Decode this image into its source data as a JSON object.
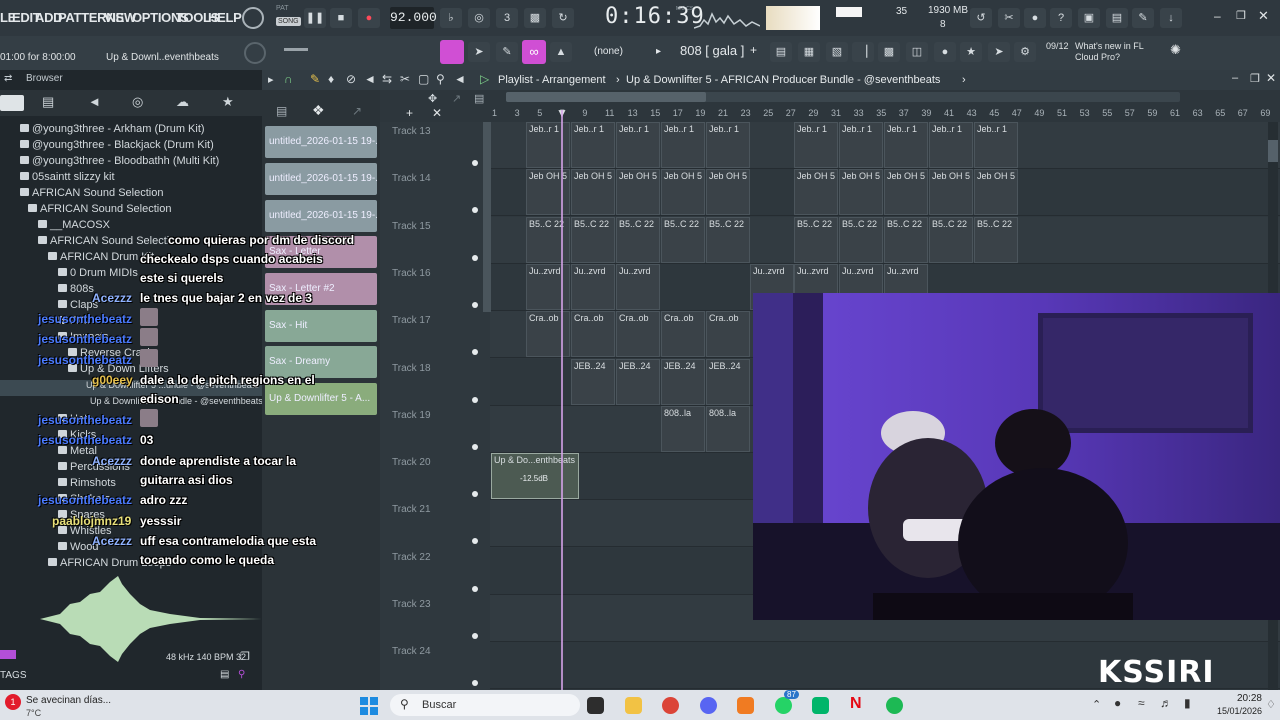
{
  "menu": {
    "items": [
      "LE",
      "EDIT",
      "ADD",
      "PATTERNS",
      "VIEW",
      "OPTIONS",
      "TOOLS",
      "HELP"
    ],
    "song_label": "SONG",
    "pat_label": "PAT"
  },
  "transport": {
    "tempo": "92.000",
    "clock": "0:16:39",
    "clock_unit": "M:S:CS",
    "cpu_percent": "35",
    "memory": "1930 MB",
    "voices": "8"
  },
  "hint_bar": {
    "time": "01:00 for 8:00:00",
    "project": "Up & Downl..eventhbeats",
    "pattern_name": "(none)",
    "channel_name": "808 [ gala ]",
    "news_counter": "09/12",
    "news_text": "What's new in FL Cloud Pro?"
  },
  "browser": {
    "title": "Browser",
    "items": [
      {
        "label": "@young3three - Arkham (Drum Kit)"
      },
      {
        "label": "@young3three - Blackjack (Drum Kit)"
      },
      {
        "label": "@young3three - Bloodbathh (Multi Kit)"
      },
      {
        "label": "05saintt slizzy kit"
      },
      {
        "label": "AFRICAN Sound Selection"
      },
      {
        "label": "AFRICAN Sound Selection"
      },
      {
        "label": "__MACOSX"
      },
      {
        "label": "AFRICAN Sound Selection"
      },
      {
        "label": "AFRICAN Drum Kit"
      },
      {
        "label": "0 Drum MIDIs"
      },
      {
        "label": "808s"
      },
      {
        "label": "Claps"
      },
      {
        "label": "FXs"
      },
      {
        "label": "Impacts"
      },
      {
        "label": "Reverse Crash"
      },
      {
        "label": "Up & Down Lifters"
      },
      {
        "label": "Up & Downlifter 5 ...undle - @seventhbeats"
      },
      {
        "label": "Up & Downlifter 5 ...undle - @seventhbeats"
      },
      {
        "label": "Hats"
      },
      {
        "label": "Kicks"
      },
      {
        "label": "Metal"
      },
      {
        "label": "Percussions"
      },
      {
        "label": "Rimshots"
      },
      {
        "label": "Shakers"
      },
      {
        "label": "Snares"
      },
      {
        "label": "Whistles"
      },
      {
        "label": "Wood"
      },
      {
        "label": "AFRICAN Drum Loops"
      }
    ],
    "sample_info": "48 kHz 140 BPM 32",
    "tags_label": "TAGS"
  },
  "patterns": [
    {
      "label": "untitled_2026-01-15 19-..."
    },
    {
      "label": "untitled_2026-01-15 19-..."
    },
    {
      "label": "untitled_2026-01-15 19-..."
    },
    {
      "label": "Sax - Letter"
    },
    {
      "label": "Sax - Letter #2"
    },
    {
      "label": "Sax - Hit"
    },
    {
      "label": "Sax - Dreamy"
    },
    {
      "label": "Up & Downlifter 5 - A..."
    }
  ],
  "playlist": {
    "title": "Playlist - Arrangement",
    "breadcrumb": "Up & Downlifter 5 - AFRICAN Producer Bundle - @seventhbeats",
    "ruler": [
      "1",
      "3",
      "5",
      "7",
      "9",
      "11",
      "13",
      "15",
      "17",
      "19",
      "21",
      "23",
      "25",
      "27",
      "29",
      "31",
      "33",
      "35",
      "37",
      "39",
      "41",
      "43",
      "45",
      "47",
      "49",
      "51",
      "53",
      "55",
      "57",
      "59",
      "61",
      "63",
      "65",
      "67",
      "69"
    ],
    "tracks": [
      {
        "name": "Track 13",
        "clip_label": "Jeb..r 1"
      },
      {
        "name": "Track 14",
        "clip_label": "Jeb OH 5"
      },
      {
        "name": "Track 15",
        "clip_label": "B5..C 22"
      },
      {
        "name": "Track 16",
        "clip_label": "Ju..zvrd"
      },
      {
        "name": "Track 17",
        "clip_label": "Cra..ob"
      },
      {
        "name": "Track 18",
        "clip_label": "JEB..24"
      },
      {
        "name": "Track 19",
        "clip_label": "808..la"
      },
      {
        "name": "Track 20",
        "clip_label": "Up & Do...enthbeats"
      },
      {
        "name": "Track 21",
        "clip_label": ""
      },
      {
        "name": "Track 22",
        "clip_label": ""
      },
      {
        "name": "Track 23",
        "clip_label": ""
      },
      {
        "name": "Track 24",
        "clip_label": ""
      }
    ],
    "gain_readout": "-12.5dB"
  },
  "chat": [
    {
      "user": "",
      "text": "como quieras por dm de discord"
    },
    {
      "user": "",
      "text": "checkealo dsps cuando acabeis"
    },
    {
      "user": "",
      "text": "este si querels"
    },
    {
      "user": "Acezzz",
      "text": "le tnes que bajar 2 en vez de 3"
    },
    {
      "user": "jesusonthebeatz",
      "text": ""
    },
    {
      "user": "jesusonthebeatz",
      "text": ""
    },
    {
      "user": "jesusonthebeatz",
      "text": ""
    },
    {
      "user": "g00eey",
      "text": "dale a lo de pitch regions en el"
    },
    {
      "user": "",
      "text": "edison"
    },
    {
      "user": "jesusonthebeatz",
      "text": ""
    },
    {
      "user": "jesusonthebeatz",
      "text": "03"
    },
    {
      "user": "Acezzz",
      "text": "donde aprendiste a tocar la"
    },
    {
      "user": "",
      "text": "guitarra asi dios"
    },
    {
      "user": "jesusonthebeatz",
      "text": "adro zzz"
    },
    {
      "user": "paablojmnz19",
      "text": "yesssir"
    },
    {
      "user": "Acezzz",
      "text": "uff esa contramelodia que esta"
    },
    {
      "user": "",
      "text": "tocando como le queda"
    }
  ],
  "webcam": {
    "logo": "KSSIRI"
  },
  "taskbar": {
    "weather_text": "Se avecinan días...",
    "temperature": "7°C",
    "search_placeholder": "Buscar",
    "time": "20:28",
    "date": "15/01/2026",
    "badge_whatsapp": "87",
    "notif_count": "1"
  },
  "colors": {
    "accent_pink": "#d04fd4",
    "accent_green": "#7fd18b",
    "chat_user_acezzz": "#8fb2ff",
    "chat_user_jesus": "#4b7bff",
    "chat_user_g00eey": "#e5c04d",
    "chat_user_paablo": "#e8e07a"
  }
}
